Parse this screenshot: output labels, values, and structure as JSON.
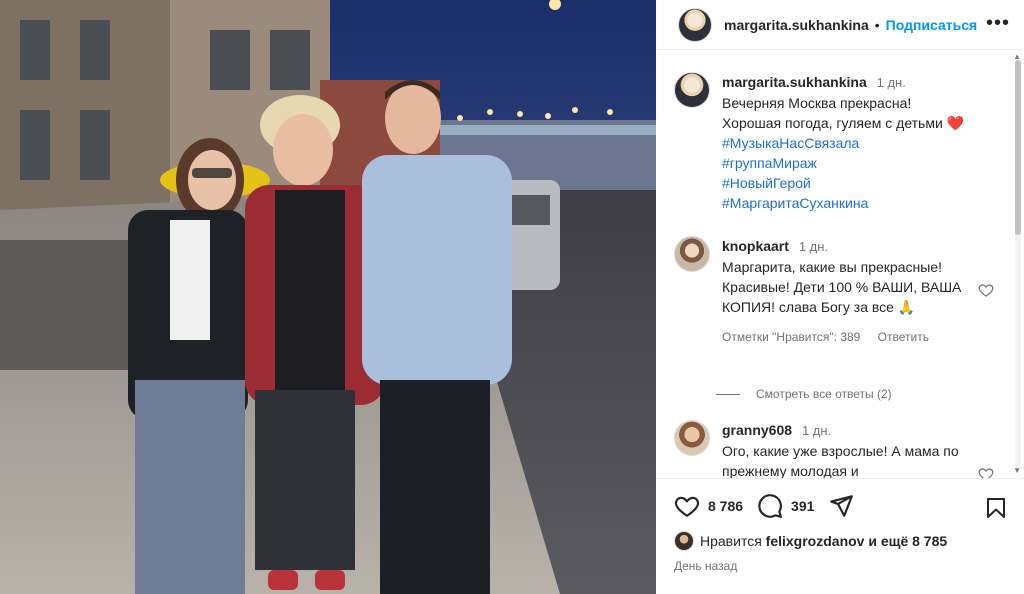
{
  "header": {
    "username": "margarita.sukhankina",
    "dot": "•",
    "follow_label": "Подписаться",
    "more_icon": "more-horizontal-icon"
  },
  "caption": {
    "username": "margarita.sukhankina",
    "age": "1 дн.",
    "text_line1": "Вечерняя Москва прекрасна!",
    "text_line2": "Хорошая погода, гуляем с детьми",
    "emoji": "❤️",
    "hashtags": [
      "#МузыкаНасСвязала",
      "#группаМираж",
      "#НовыйГерой",
      "#МаргаритаСуханкина"
    ]
  },
  "comments": [
    {
      "username": "knopkaart",
      "age": "1 дн.",
      "text": "Маргарита, какие вы прекрасные! Красивые! Дети 100 % ВАШИ, ВАША КОПИЯ! слава Богу за все 🙏",
      "likes_label": "Отметки \"Нравится\": 389",
      "reply_label": "Ответить"
    },
    {
      "username": "granny608",
      "age": "1 дн.",
      "text": "Ого, какие уже взрослые! А мама по прежнему молодая и"
    }
  ],
  "view_replies_label": "Смотреть все ответы (2)",
  "actions": {
    "likes_count": "8 786",
    "comments_count": "391"
  },
  "liked_by": {
    "prefix": "Нравится",
    "user": "felixgrozdanov",
    "suffix": "и ещё 8 785"
  },
  "time_ago": "День назад",
  "colors": {
    "link": "#0095f6",
    "hashtag": "#1f6fcf",
    "heart": "#ed4956"
  }
}
